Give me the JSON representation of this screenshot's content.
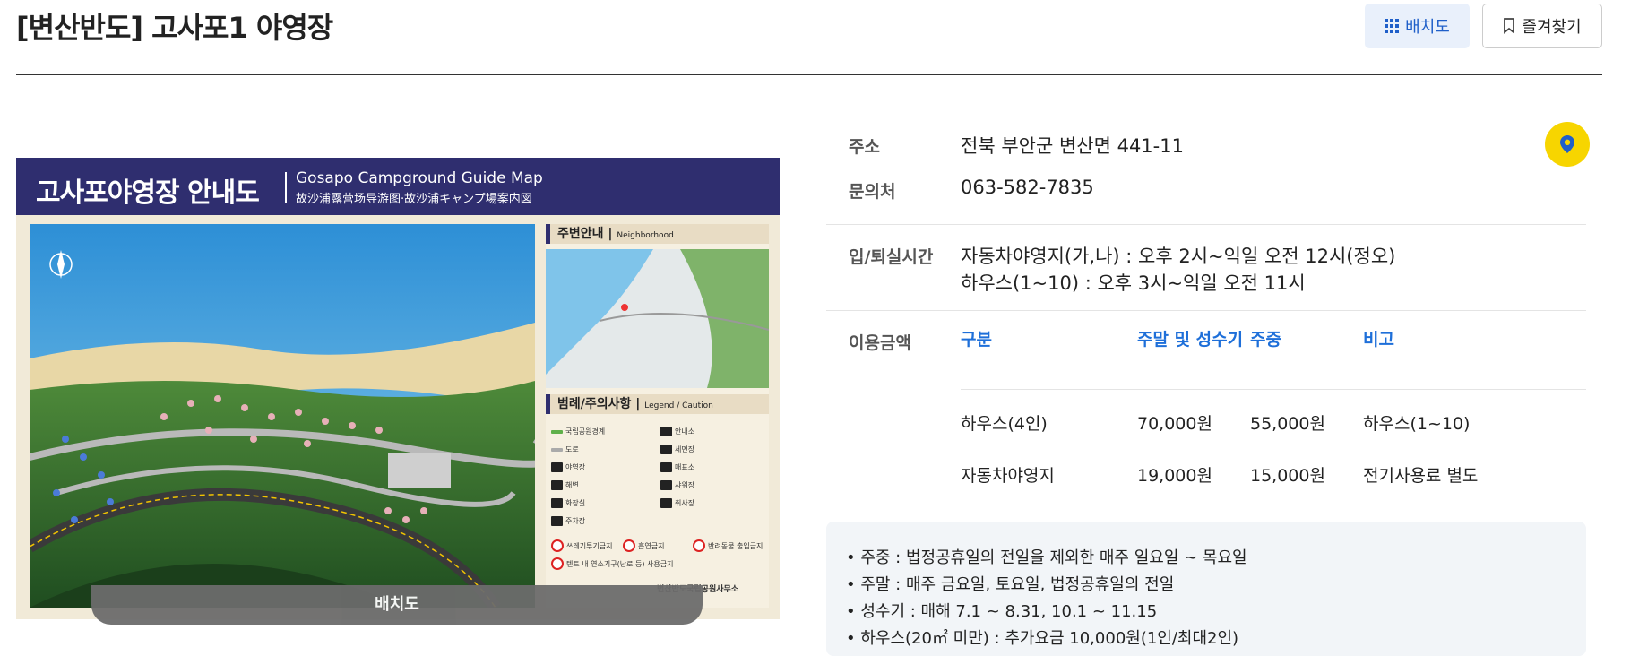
{
  "header": {
    "title": "[변산반도] 고사포1 야영장",
    "map_button": "배치도",
    "favorite_button": "즐겨찾기"
  },
  "map": {
    "title_ko": "고사포야영장 안내도",
    "title_en": "Gosapo Campground Guide Map",
    "title_cn": "故沙浦露营场导游图·故沙浦キャンプ場案内図",
    "neighborhood_heading": "주변안내",
    "neighborhood_sub": "Neighborhood",
    "legend_heading": "범례/주의사항",
    "legend_sub": "Legend / Caution",
    "legend_items": [
      "국립공원경계",
      "안내소",
      "도로",
      "세면장",
      "야영장",
      "매표소",
      "해변",
      "샤워장",
      "화장실",
      "취사장",
      "주차장",
      "쓰레기투기금지",
      "흡연금지",
      "반려동물 출입금지",
      "텐트 내 연소기구(난로 등) 사용금지"
    ],
    "footer_org": "변산반도국립공원사무소",
    "caption": "배치도"
  },
  "info": {
    "address_label": "주소",
    "address": "전북 부안군 변산면 441-11",
    "phone_label": "문의처",
    "phone": "063-582-7835",
    "checkin_label": "입/퇴실시간",
    "checkin_line1": "자동차야영지(가,나) : 오후 2시~익일 오전 12시(정오)",
    "checkin_line2": "하우스(1~10) : 오후 3시~익일 오전 11시",
    "price_label": "이용금액",
    "price_headers": [
      "구분",
      "주말 및 성수기",
      "주중",
      "비고"
    ],
    "price_rows": [
      [
        "하우스(4인)",
        "70,000원",
        "55,000원",
        "하우스(1~10)"
      ],
      [
        "자동차야영지",
        "19,000원",
        "15,000원",
        "전기사용료 별도"
      ]
    ]
  },
  "notes": [
    "주중 : 법정공휴일의 전일을 제외한 매주 일요일 ~ 목요일",
    "주말 : 매주 금요일, 토요일, 법정공휴일의 전일",
    "성수기 : 매해 7.1 ~ 8.31, 10.1 ~ 11.15",
    "하우스(20㎡ 미만) : 추가요금 10,000원(1인/최대2인)"
  ],
  "colors": {
    "accent": "#1e6fd9",
    "map_header": "#2f2e6f",
    "pin": "#f7d500"
  }
}
